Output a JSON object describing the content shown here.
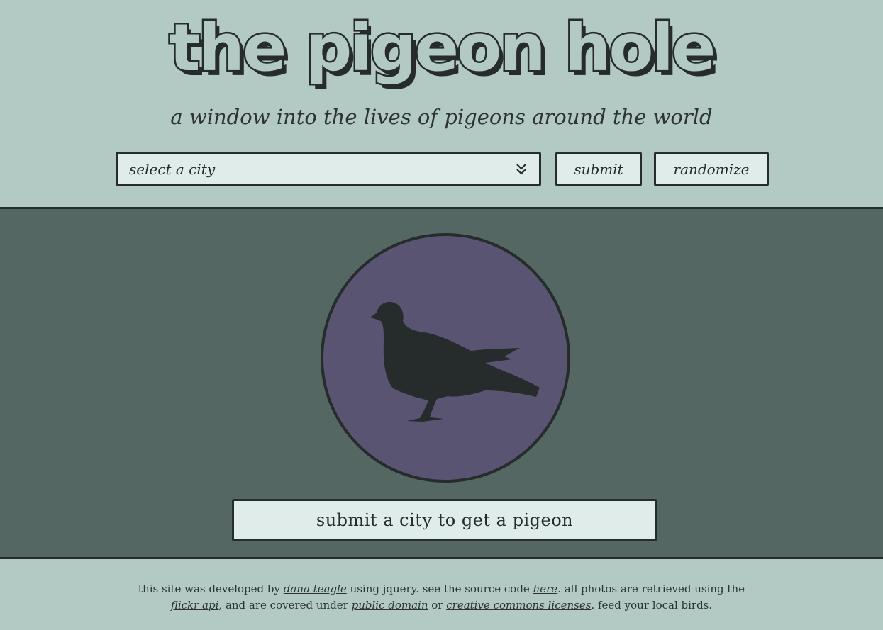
{
  "header": {
    "logo": "the pigeon hole",
    "tagline": "a window into the lives of pigeons around the world"
  },
  "controls": {
    "city_select": "select a city",
    "submit_label": "submit",
    "randomize_label": "randomize"
  },
  "main": {
    "result_text": "submit a city to get a pigeon",
    "colors": {
      "panel": "#546762",
      "circle": "#5a5473",
      "ink": "#262b2c",
      "page": "#b3c9c3",
      "box": "#e0ecea"
    }
  },
  "footer": {
    "t1": "this site was developed by ",
    "link_author": "dana teagle",
    "t2": " using jquery. see the source code ",
    "link_here": "here",
    "t3": ". all photos are retrieved using the",
    "link_flickr": "flickr api",
    "t4": ", and are covered under ",
    "link_pd": "public domain",
    "t5": " or ",
    "link_cc": "creative commons licenses",
    "t6": ". feed your local birds."
  }
}
